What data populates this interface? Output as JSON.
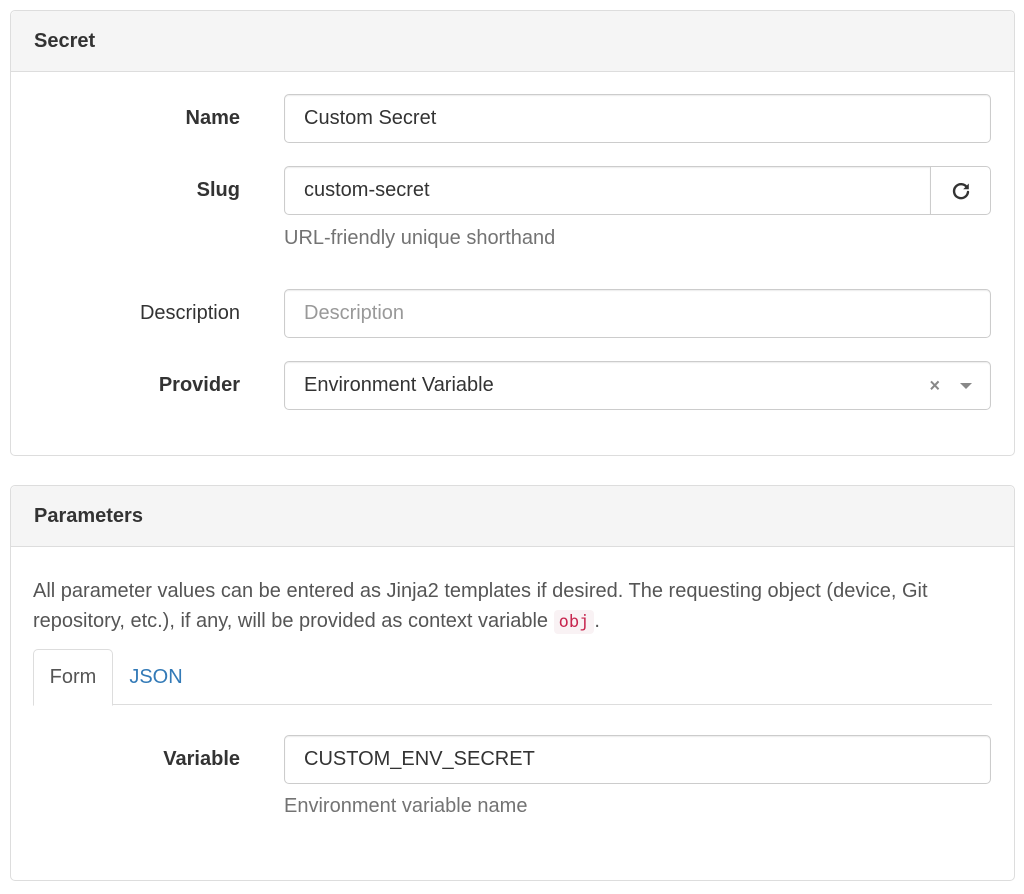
{
  "secret_panel": {
    "title": "Secret",
    "name": {
      "label": "Name",
      "value": "Custom Secret"
    },
    "slug": {
      "label": "Slug",
      "value": "custom-secret",
      "help": "URL-friendly unique shorthand",
      "refresh_icon": "refresh-icon"
    },
    "description": {
      "label": "Description",
      "placeholder": "Description"
    },
    "provider": {
      "label": "Provider",
      "value": "Environment Variable",
      "clear": "×",
      "arrow_icon": "caret-down-icon"
    }
  },
  "params_panel": {
    "title": "Parameters",
    "intro_before": "All parameter values can be entered as Jinja2 templates if desired. The requesting object (device, Git repository, etc.), if any, will be provided as context variable ",
    "intro_code": "obj",
    "intro_after": ".",
    "tabs": [
      {
        "label": "Form",
        "active": true
      },
      {
        "label": "JSON",
        "active": false
      }
    ],
    "variable": {
      "label": "Variable",
      "value": "CUSTOM_ENV_SECRET",
      "help": "Environment variable name"
    }
  },
  "colors": {
    "link": "#337ab7",
    "code_text": "#c7254e",
    "code_bg": "#f9f2f4",
    "panel_heading_bg": "#f5f5f5"
  }
}
